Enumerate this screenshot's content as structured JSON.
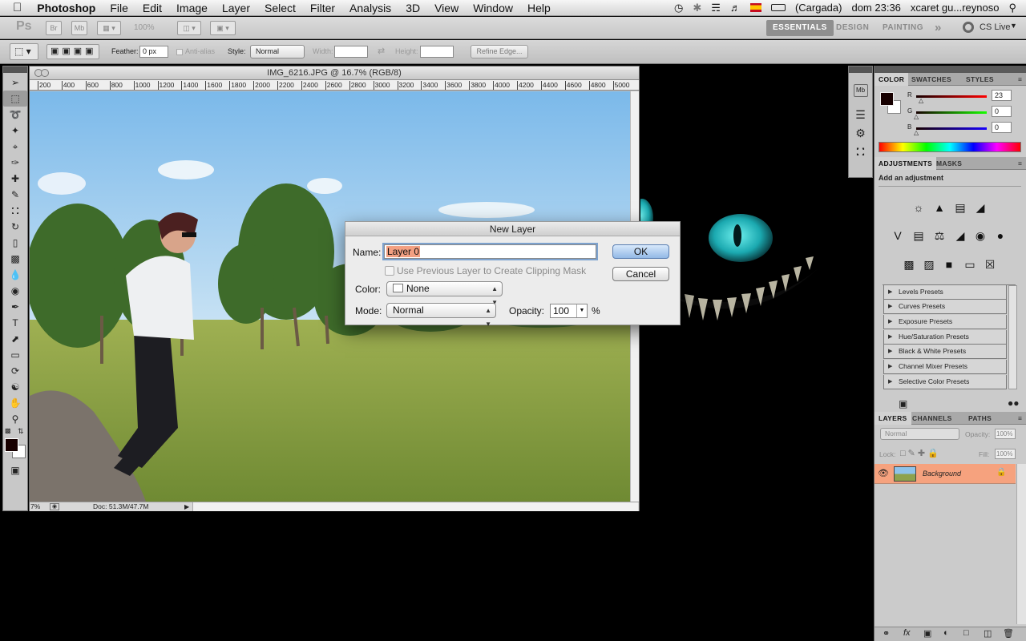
{
  "menubar": {
    "apple": "",
    "app": "Photoshop",
    "items": [
      "File",
      "Edit",
      "Image",
      "Layer",
      "Select",
      "Filter",
      "Analysis",
      "3D",
      "View",
      "Window",
      "Help"
    ],
    "battery": "(Cargada)",
    "clock": "dom 23:36",
    "user": "xcaret gu...reynoso"
  },
  "appbar": {
    "ps": "Ps",
    "br": "Br",
    "mb": "Mb",
    "zoom": "100%",
    "workspaces": [
      "ESSENTIALS",
      "DESIGN",
      "PAINTING"
    ],
    "more": "»",
    "cslive": "CS Live"
  },
  "optbar": {
    "feather_label": "Feather:",
    "feather_value": "0 px",
    "antialias": "Anti-alias",
    "style_label": "Style:",
    "style_value": "Normal",
    "width_label": "Width:",
    "height_label": "Height:",
    "refine": "Refine Edge..."
  },
  "document": {
    "title": "IMG_6216.JPG @ 16.7% (RGB/8)",
    "ruler": [
      "200",
      "400",
      "600",
      "800",
      "1000",
      "1200",
      "1400",
      "1600",
      "1800",
      "2000",
      "2200",
      "2400",
      "2600",
      "2800",
      "3000",
      "3200",
      "3400",
      "3600",
      "3800",
      "4000",
      "4200",
      "4400",
      "4600",
      "4800",
      "5000"
    ],
    "zoom_status": "7%",
    "doc_size": "Doc: 51.3M/47.7M"
  },
  "dialog": {
    "title": "New Layer",
    "name_label": "Name:",
    "name_value": "Layer 0",
    "clip_label": "Use Previous Layer to Create Clipping Mask",
    "color_label": "Color:",
    "color_value": "None",
    "mode_label": "Mode:",
    "mode_value": "Normal",
    "opacity_label": "Opacity:",
    "opacity_value": "100",
    "pct": "%",
    "ok": "OK",
    "cancel": "Cancel"
  },
  "color_panel": {
    "tabs": [
      "COLOR",
      "SWATCHES",
      "STYLES"
    ],
    "r_label": "R",
    "r_value": "23",
    "g_label": "G",
    "g_value": "0",
    "b_label": "B",
    "b_value": "0",
    "fg_color": "#170000"
  },
  "adjustments_panel": {
    "tabs": [
      "ADJUSTMENTS",
      "MASKS"
    ],
    "heading": "Add an adjustment",
    "presets": [
      "Levels Presets",
      "Curves Presets",
      "Exposure Presets",
      "Hue/Saturation Presets",
      "Black & White Presets",
      "Channel Mixer Presets",
      "Selective Color Presets"
    ]
  },
  "layers_panel": {
    "tabs": [
      "LAYERS",
      "CHANNELS",
      "PATHS"
    ],
    "blend": "Normal",
    "opacity_label": "Opacity:",
    "opacity_value": "100%",
    "lock_label": "Lock:",
    "fill_label": "Fill:",
    "fill_value": "100%",
    "layer_name": "Background",
    "highlight": "#f6a27e"
  }
}
